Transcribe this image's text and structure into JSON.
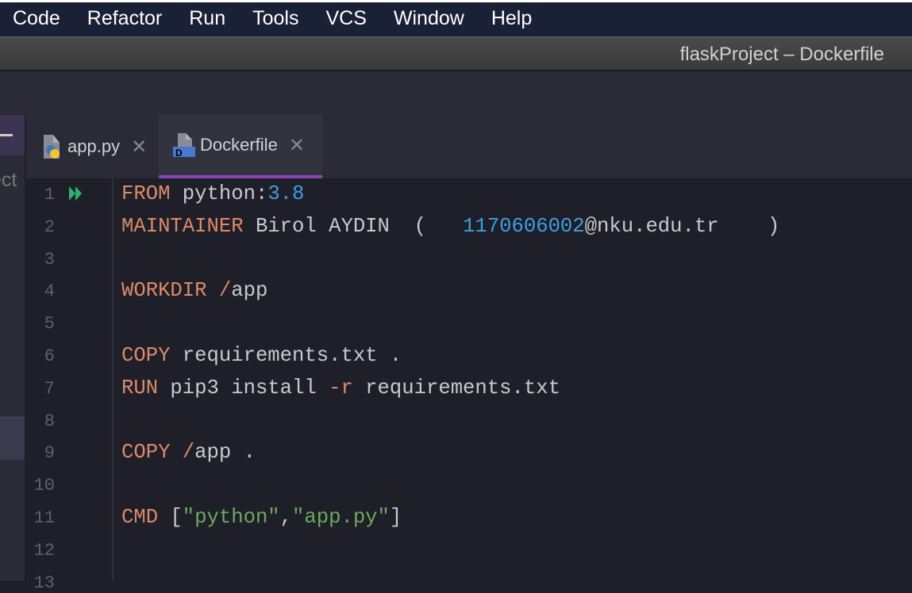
{
  "menu": [
    "Code",
    "Refactor",
    "Run",
    "Tools",
    "VCS",
    "Window",
    "Help"
  ],
  "window_title": "flaskProject – Dockerfile",
  "sidebar": {
    "label": "ect"
  },
  "tabs": [
    {
      "label": "app.py",
      "icon": "python-file-icon",
      "active": false
    },
    {
      "label": "Dockerfile",
      "icon": "dockerfile-icon",
      "active": true
    }
  ],
  "colors": {
    "keyword": "#de8a68",
    "number": "#3d9ee6",
    "string": "#6aab5e",
    "text": "#c9c9d1",
    "accent": "#8a44b8",
    "run": "#2fb36b"
  },
  "editor": {
    "lines": [
      [
        {
          "t": "FROM",
          "c": "kw"
        },
        {
          "t": " python:"
        },
        {
          "t": "3.8",
          "c": "num"
        }
      ],
      [
        {
          "t": "MAINTAINER",
          "c": "kw"
        },
        {
          "t": " Birol AYDIN  (   "
        },
        {
          "t": "1170606002",
          "c": "num"
        },
        {
          "t": "@nku.edu.tr    )"
        }
      ],
      [],
      [
        {
          "t": "WORKDIR",
          "c": "kw"
        },
        {
          "t": " "
        },
        {
          "t": "/",
          "c": "op"
        },
        {
          "t": "app"
        }
      ],
      [],
      [
        {
          "t": "COPY",
          "c": "kw"
        },
        {
          "t": " requirements.txt ."
        }
      ],
      [
        {
          "t": "RUN",
          "c": "kw"
        },
        {
          "t": " pip3 install "
        },
        {
          "t": "-r",
          "c": "op"
        },
        {
          "t": " requirements.txt"
        }
      ],
      [],
      [
        {
          "t": "COPY",
          "c": "kw"
        },
        {
          "t": " "
        },
        {
          "t": "/",
          "c": "op"
        },
        {
          "t": "app ."
        }
      ],
      [],
      [
        {
          "t": "CMD",
          "c": "kw"
        },
        {
          "t": " ["
        },
        {
          "t": "\"python\"",
          "c": "str"
        },
        {
          "t": ","
        },
        {
          "t": "\"app.py\"",
          "c": "str"
        },
        {
          "t": "]"
        }
      ],
      [],
      []
    ],
    "line_numbers": [
      "1",
      "2",
      "3",
      "4",
      "5",
      "6",
      "7",
      "8",
      "9",
      "10",
      "11",
      "12",
      "13"
    ]
  }
}
